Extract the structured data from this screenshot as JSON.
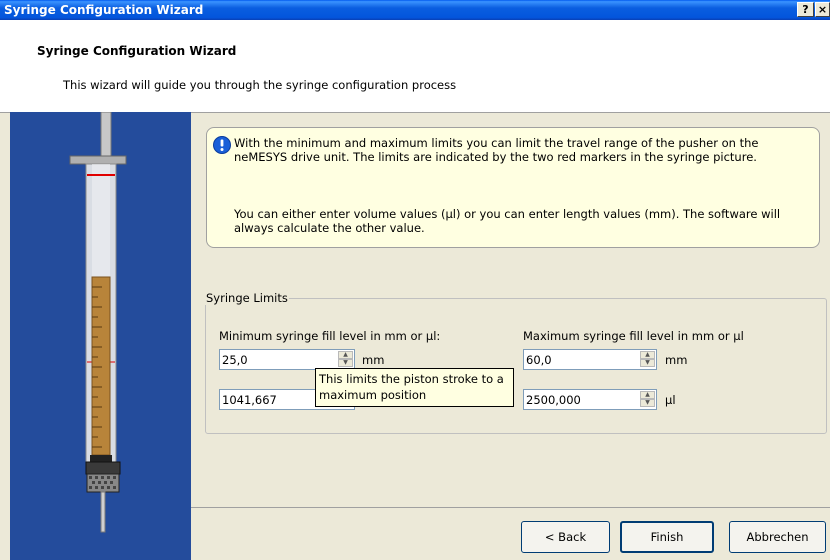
{
  "window": {
    "title": "Syringe Configuration Wizard",
    "help_glyph": "?",
    "close_glyph": "×"
  },
  "header": {
    "title": "Syringe Configuration Wizard",
    "subtitle": "This wizard will guide you through the syringe configuration process"
  },
  "info": {
    "icon": "exclamation-icon",
    "paragraph1": "With the minimum and maximum limits you can limit the travel range of the pusher on the neMESYS drive unit. The limits are indicated by the two red markers in the syringe picture.",
    "paragraph2": "You can either enter volume values (µl) or you can enter length values (mm). The software will always calculate the other value."
  },
  "limits": {
    "group_label": "Syringe Limits",
    "min_label": "Minimum syringe fill level in mm or µl:",
    "max_label": "Maximum syringe fill level in mm or µl",
    "min_mm": "25,0",
    "min_ul": "1041,667",
    "max_mm": "60,0",
    "max_ul": "2500,000",
    "unit_mm": "mm",
    "unit_ul": "µl"
  },
  "tooltip": {
    "line1": "This limits the piston stroke to a",
    "line2": "maximum position"
  },
  "buttons": {
    "back": "< Back",
    "finish": "Finish",
    "cancel": "Abbrechen"
  },
  "colors": {
    "titlebar": "#0a5ee0",
    "panel": "#244c9c",
    "info_bg": "#ffffe1",
    "fill": "#b8843a"
  }
}
